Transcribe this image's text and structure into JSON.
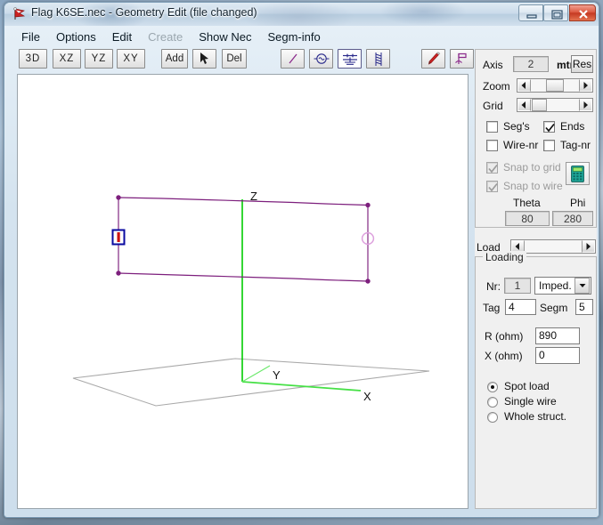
{
  "window": {
    "title": "Flag K6SE.nec - Geometry Edit (file changed)",
    "app_icon": "flag-icon",
    "buttons": {
      "minimize": "minimize-icon",
      "maximize": "maximize-icon",
      "close": "close-icon"
    }
  },
  "menu": [
    {
      "label": "File",
      "disabled": false
    },
    {
      "label": "Options",
      "disabled": false
    },
    {
      "label": "Edit",
      "disabled": false
    },
    {
      "label": "Create",
      "disabled": true
    },
    {
      "label": "Show Nec",
      "disabled": false
    },
    {
      "label": "Segm-info",
      "disabled": false
    }
  ],
  "toolbar": {
    "views": [
      {
        "label": "3D",
        "pressed": false
      },
      {
        "label": "XZ",
        "pressed": false
      },
      {
        "label": "YZ",
        "pressed": false
      },
      {
        "label": "XY",
        "pressed": false
      }
    ],
    "edit": [
      {
        "label": "Add",
        "icon": "add-label",
        "pressed": false
      },
      {
        "label": "",
        "icon": "cursor-arrow-icon",
        "pressed": false
      },
      {
        "label": "Del",
        "icon": "del-label",
        "pressed": false
      }
    ],
    "tools": [
      {
        "icon": "wire-icon",
        "pressed": false
      },
      {
        "icon": "source-icon",
        "pressed": false
      },
      {
        "icon": "load-icon",
        "pressed": true
      },
      {
        "icon": "coil-icon",
        "pressed": false
      },
      {
        "icon": "pencil-icon",
        "pressed": false
      },
      {
        "icon": "flag-marker-icon",
        "pressed": false
      },
      {
        "icon": "ground-icon",
        "pressed": false
      }
    ]
  },
  "view_panel": {
    "axis_label": "Axis",
    "axis_value": "2",
    "unit_label": "mtr",
    "res_button": "Res",
    "zoom_label": "Zoom",
    "zoom_thumb_pct": 46,
    "grid_label": "Grid",
    "grid_thumb_pct": 18,
    "checkboxes": [
      {
        "label": "Seg's",
        "checked": false,
        "disabled": false
      },
      {
        "label": "Ends",
        "checked": true,
        "disabled": false
      },
      {
        "label": "Wire-nr",
        "checked": false,
        "disabled": false
      },
      {
        "label": "Tag-nr",
        "checked": false,
        "disabled": false
      },
      {
        "label": "Snap to grid",
        "checked": true,
        "disabled": true
      },
      {
        "label": "Snap to wire",
        "checked": true,
        "disabled": true
      }
    ],
    "calc_icon": "calculator-icon",
    "theta_label": "Theta",
    "theta_value": "80",
    "phi_label": "Phi",
    "phi_value": "280"
  },
  "load_scroll": {
    "label": "Load"
  },
  "loading": {
    "group_title": "Loading",
    "nr_label": "Nr:",
    "nr_value": "1",
    "type_value": "Imped.",
    "tag_label": "Tag",
    "tag_value": "4",
    "segm_label": "Segm",
    "segm_value": "5",
    "r_label": "R (ohm)",
    "r_value": "890",
    "x_label": "X (ohm)",
    "x_value": "0",
    "scope_options": [
      {
        "label": "Spot load",
        "selected": true
      },
      {
        "label": "Single wire",
        "selected": false
      },
      {
        "label": "Whole struct.",
        "selected": false
      }
    ]
  },
  "canvas": {
    "axis_labels": {
      "x": "X",
      "y": "Y",
      "z": "Z"
    },
    "colors": {
      "wire": "#6b0d6b",
      "wire_light": "#d89fd8",
      "axis": "#00d000",
      "ground": "#a8a8a8",
      "load_marker_border": "#0a0aa0",
      "load_marker_fill": "#cc1111",
      "source_marker": "#dda0dd"
    },
    "markers": [
      {
        "name": "load-marker",
        "kind": "rect"
      },
      {
        "name": "source-marker",
        "kind": "circle"
      }
    ]
  }
}
